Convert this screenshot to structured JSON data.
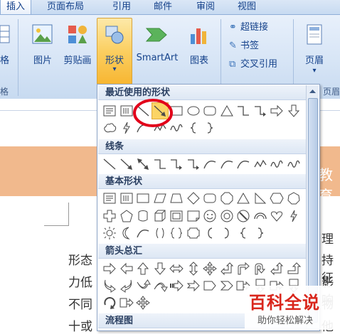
{
  "tabs": [
    "插入",
    "页面布局",
    "引用",
    "邮件",
    "审阅",
    "视图"
  ],
  "ribbon": {
    "left_partial_label": "格",
    "left_group_label": "格",
    "buttons": [
      "图片",
      "剪贴画",
      "形状",
      "SmartArt",
      "图表"
    ],
    "shape_dropdown": "▾",
    "links": [
      "超链接",
      "书签",
      "交叉引用"
    ],
    "header_button": "页眉",
    "header_group_label": "页眉",
    "header_dropdown": "▾"
  },
  "menu": {
    "sections": [
      "最近使用的形状",
      "线条",
      "基本形状",
      "箭头总汇",
      "流程图"
    ]
  },
  "document": {
    "lines_left": [
      "形态",
      "力低",
      "不同",
      "十或"
    ],
    "banner_partial": "教育",
    "lines_right": [
      "理",
      "持征",
      "影响",
      "物",
      "他"
    ]
  },
  "colors": {
    "highlight": "#fbd465",
    "circle": "#e2001a",
    "watermark_red": "#d9261c",
    "watermark_green": "#2fa84f"
  },
  "watermark": {
    "title": "百科全说",
    "subtitle": "助你轻松解决"
  }
}
